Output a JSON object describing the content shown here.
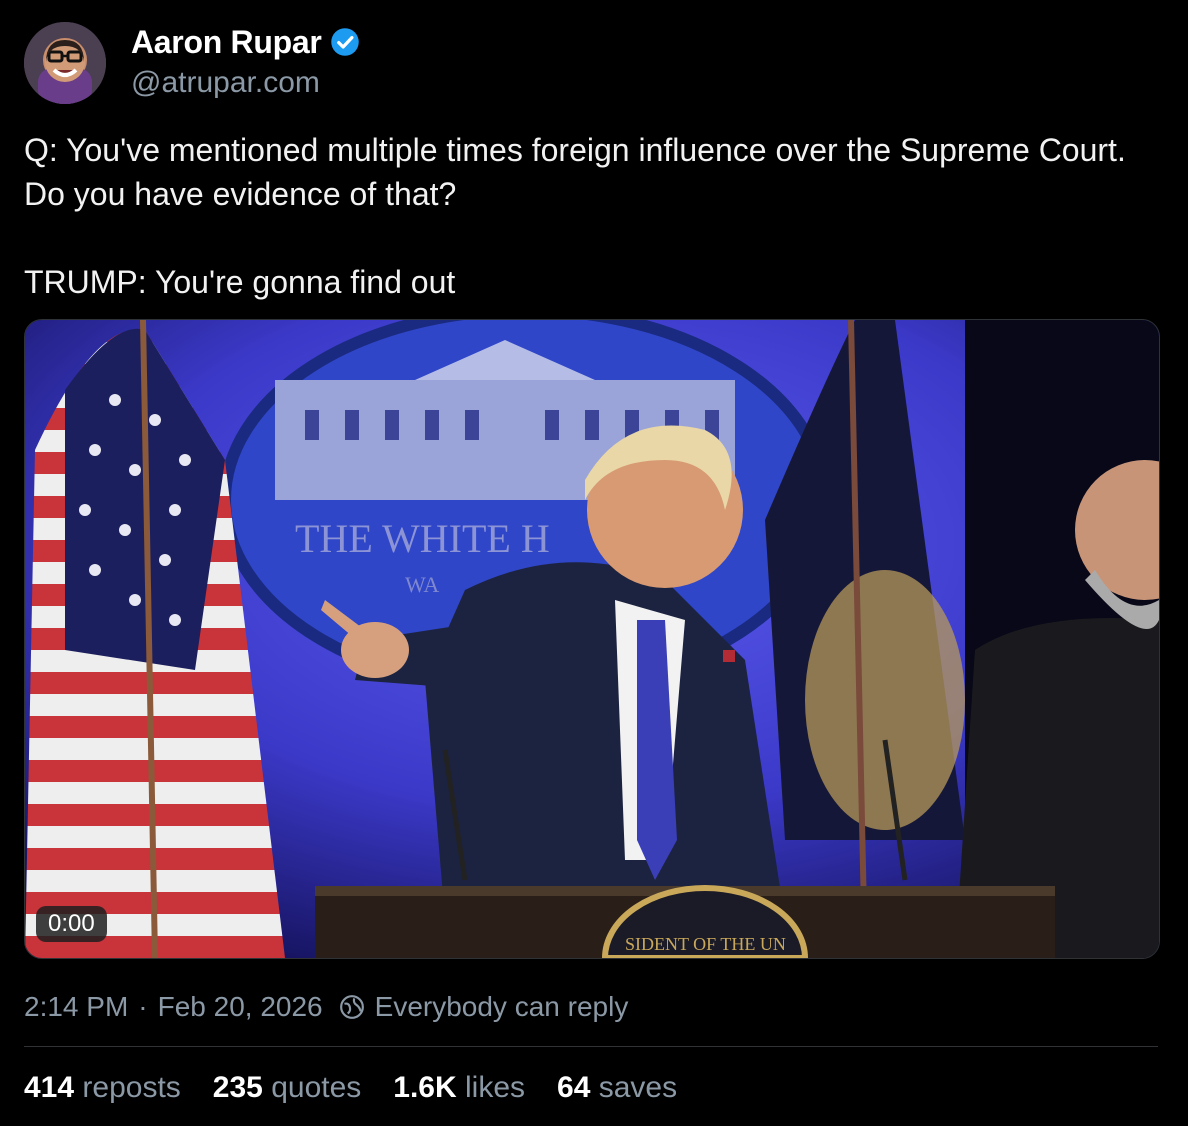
{
  "author": {
    "name": "Aaron Rupar",
    "handle": "@atrupar.com",
    "verified_icon": "verified-check-icon",
    "verified_color": "#1d9bf0"
  },
  "post": {
    "text": "Q: You've mentioned multiple times foreign influence over the Supreme Court. Do you have evidence of that?\n\nTRUMP: You're gonna find out"
  },
  "video": {
    "timestamp": "0:00",
    "backdrop_text": "THE WHITE H",
    "backdrop_subtext": "WA",
    "seal_text": "SIDENT OF THE UN"
  },
  "meta": {
    "time": "2:14 PM",
    "separator": "·",
    "date": "Feb 20, 2026",
    "reply_setting": "Everybody can reply",
    "reply_icon": "globe-icon"
  },
  "stats": [
    {
      "value": "414",
      "label": "reposts"
    },
    {
      "value": "235",
      "label": "quotes"
    },
    {
      "value": "1.6K",
      "label": "likes"
    },
    {
      "value": "64",
      "label": "saves"
    }
  ],
  "colors": {
    "background": "#000000",
    "secondary_text": "#8b98a5",
    "divider": "#2f3336",
    "backdrop_blue": "#3e3ccf"
  }
}
